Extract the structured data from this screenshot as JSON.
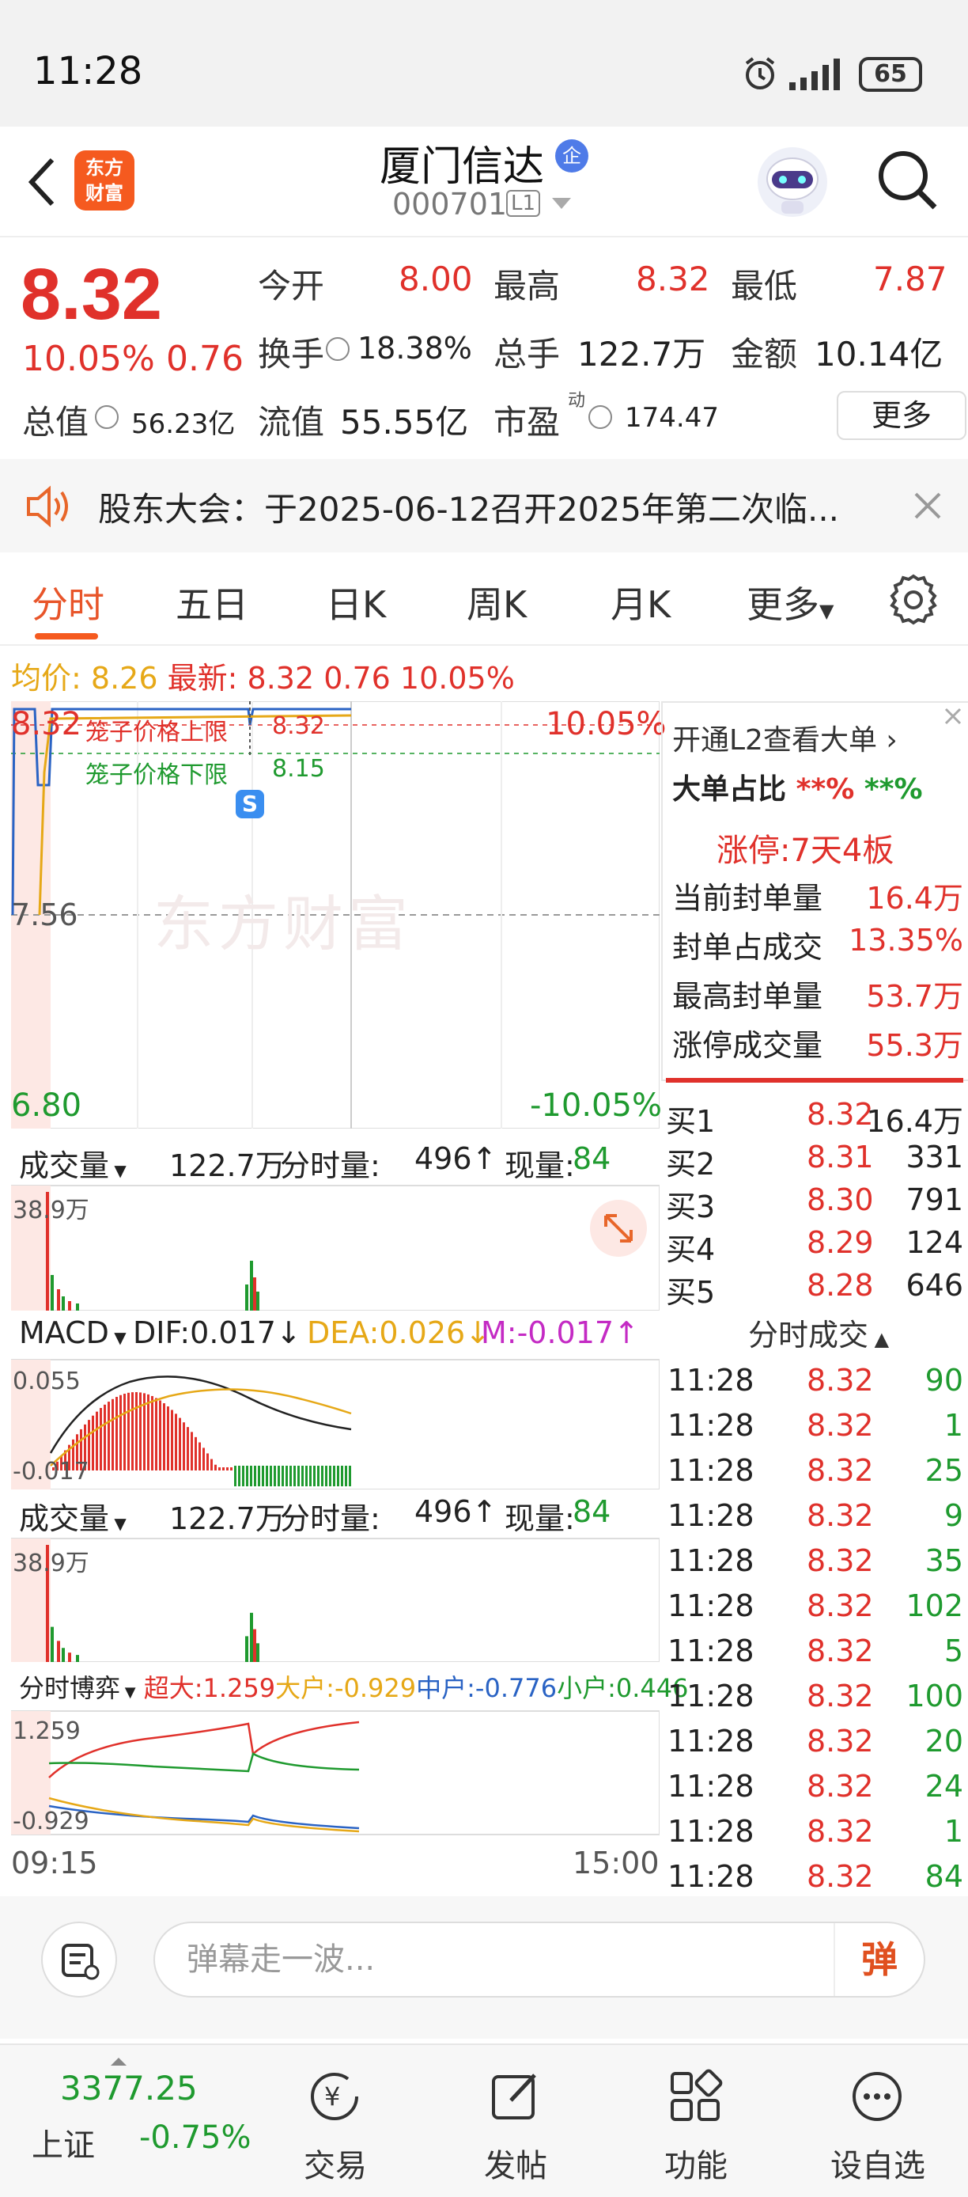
{
  "status": {
    "time": "11:28",
    "battery": "65"
  },
  "header": {
    "logo_line1": "东方",
    "logo_line2": "财富",
    "stock_name": "厦门信达",
    "qi_badge": "企",
    "code": "000701",
    "level": "L1"
  },
  "quote": {
    "price": "8.32",
    "pct": "10.05%",
    "chg": "0.76",
    "open_label": "今开",
    "open": "8.00",
    "high_label": "最高",
    "high": "8.32",
    "low_label": "最低",
    "low": "7.87",
    "turnover_label": "换手",
    "turnover": "18.38%",
    "volume_label": "总手",
    "volume": "122.7万",
    "amount_label": "金额",
    "amount": "10.14亿",
    "mktcap_label": "总值",
    "mktcap": "56.23亿",
    "float_label": "流值",
    "float": "55.55亿",
    "pe_label": "市盈",
    "pe_sup": "动",
    "pe": "174.47",
    "more": "更多"
  },
  "notice": {
    "text": "股东大会：于2025-06-12召开2025年第二次临..."
  },
  "tabs": [
    "分时",
    "五日",
    "日K",
    "周K",
    "月K",
    "更多"
  ],
  "avg": {
    "avg_label": "均价:",
    "avg": "8.26",
    "last_label": "最新:",
    "last": "8.32",
    "chg": "0.76",
    "pct": "10.05%"
  },
  "chart": {
    "top_price": "8.32",
    "upper_label": "笼子价格上限",
    "upper": "8.32",
    "top_pct": "10.05%",
    "lower_label": "笼子价格下限",
    "lower": "8.15",
    "s_badge": "S",
    "mid_price": "7.56",
    "watermark": "东方财富",
    "bottom_price": "6.80",
    "bottom_pct": "-10.05%",
    "vol_label": "成交量",
    "vol_total": "122.7万",
    "vol_fen_label": "分时量:",
    "vol_fen": "496↑",
    "vol_now_label": "现量:",
    "vol_now": "84",
    "vol_max": "38.9万",
    "macd_label": "MACD",
    "dif": "DIF:0.017↓",
    "dea": "DEA:0.026↓",
    "m": "M:-0.017↑",
    "macd_top": "0.055",
    "macd_bottom": "-0.017",
    "vol2_label": "成交量",
    "vol2_total": "122.7万",
    "vol2_fen_label": "分时量:",
    "vol2_fen": "496↑",
    "vol2_now_label": "现量:",
    "vol2_now": "84",
    "vol2_max": "38.9万",
    "bo_label": "分时博弈",
    "super": "超大:1.259",
    "big": "大户:-0.929",
    "mid": "中户:-0.776",
    "small": "小户:0.446",
    "bo_top": "1.259",
    "bo_bottom": "-0.929",
    "time_start": "09:15",
    "time_end": "15:00",
    "colors": {
      "price_line": "#2a63c4",
      "avg_line": "#e6a817",
      "up": "#e0312b",
      "down": "#1f9a2f",
      "dif": "#222222",
      "dea": "#e6a817"
    }
  },
  "right_panel": {
    "l2_label": "开通L2查看大单",
    "big_ratio_label": "大单占比",
    "big_ratio_a": "**%",
    "big_ratio_b": "**%",
    "limit_label": "涨停:",
    "limit_value": "7天4板",
    "stats": [
      {
        "label": "当前封单量",
        "value": "16.4万"
      },
      {
        "label": "封单占成交",
        "value": "13.35%"
      },
      {
        "label": "最高封单量",
        "value": "53.7万"
      },
      {
        "label": "涨停成交量",
        "value": "55.3万"
      }
    ],
    "bids": [
      {
        "label": "买1",
        "price": "8.32",
        "vol": "16.4万"
      },
      {
        "label": "买2",
        "price": "8.31",
        "vol": "331"
      },
      {
        "label": "买3",
        "price": "8.30",
        "vol": "791"
      },
      {
        "label": "买4",
        "price": "8.29",
        "vol": "124"
      },
      {
        "label": "买5",
        "price": "8.28",
        "vol": "646"
      }
    ],
    "ticks_label": "分时成交",
    "ticks": [
      {
        "t": "11:28",
        "p": "8.32",
        "v": "90"
      },
      {
        "t": "11:28",
        "p": "8.32",
        "v": "1"
      },
      {
        "t": "11:28",
        "p": "8.32",
        "v": "25"
      },
      {
        "t": "11:28",
        "p": "8.32",
        "v": "9"
      },
      {
        "t": "11:28",
        "p": "8.32",
        "v": "35"
      },
      {
        "t": "11:28",
        "p": "8.32",
        "v": "102"
      },
      {
        "t": "11:28",
        "p": "8.32",
        "v": "5"
      },
      {
        "t": "11:28",
        "p": "8.32",
        "v": "100"
      },
      {
        "t": "11:28",
        "p": "8.32",
        "v": "20"
      },
      {
        "t": "11:28",
        "p": "8.32",
        "v": "24"
      },
      {
        "t": "11:28",
        "p": "8.32",
        "v": "1"
      },
      {
        "t": "11:28",
        "p": "8.32",
        "v": "84"
      }
    ]
  },
  "comment": {
    "placeholder": "弹幕走一波...",
    "danmu": "弹"
  },
  "bottom_nav": {
    "index_value": "3377.25",
    "index_name": "上证",
    "index_pct": "-0.75%",
    "trade": "交易",
    "post": "发帖",
    "func": "功能",
    "watch": "设自选"
  }
}
